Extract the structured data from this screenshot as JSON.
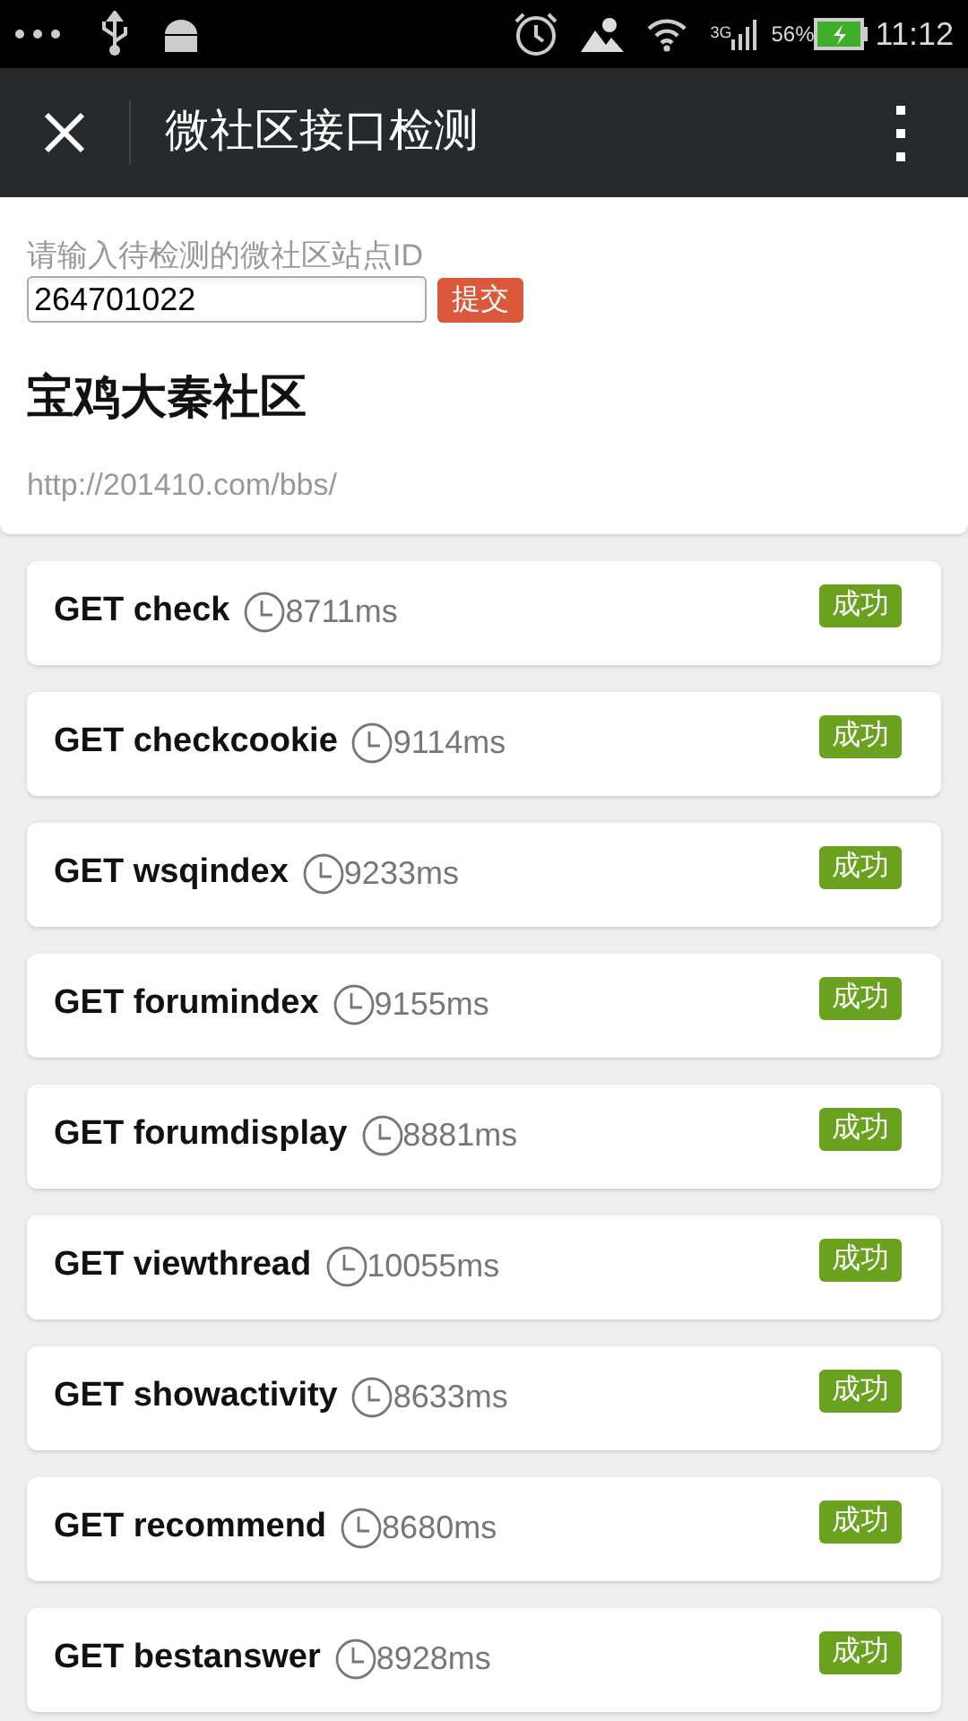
{
  "status_bar": {
    "network": "3G",
    "battery": "56%",
    "time": "11:12"
  },
  "toolbar": {
    "title": "微社区接口检测"
  },
  "form": {
    "label": "请输入待检测的微社区站点ID",
    "value": "264701022",
    "submit": "提交"
  },
  "site": {
    "name": "宝鸡大秦社区",
    "url": "http://201410.com/bbs/"
  },
  "results": [
    {
      "name": "GET check",
      "time": "8711ms",
      "status": "成功"
    },
    {
      "name": "GET checkcookie",
      "time": "9114ms",
      "status": "成功"
    },
    {
      "name": "GET wsqindex",
      "time": "9233ms",
      "status": "成功"
    },
    {
      "name": "GET forumindex",
      "time": "9155ms",
      "status": "成功"
    },
    {
      "name": "GET forumdisplay",
      "time": "8881ms",
      "status": "成功"
    },
    {
      "name": "GET viewthread",
      "time": "10055ms",
      "status": "成功"
    },
    {
      "name": "GET showactivity",
      "time": "8633ms",
      "status": "成功"
    },
    {
      "name": "GET recommend",
      "time": "8680ms",
      "status": "成功"
    },
    {
      "name": "GET bestanswer",
      "time": "8928ms",
      "status": "成功"
    }
  ]
}
